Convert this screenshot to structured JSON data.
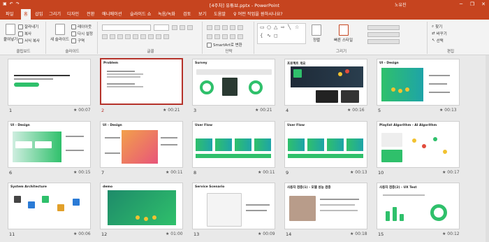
{
  "titlebar": {
    "doc_title": "[4주차] 유튜브.pptx  -  PowerPoint",
    "user": "노유진",
    "minimize": "─",
    "restore": "❐",
    "close": "✕"
  },
  "tabs": [
    {
      "label": "파일"
    },
    {
      "label": "홈"
    },
    {
      "label": "삽입"
    },
    {
      "label": "그리기"
    },
    {
      "label": "디자인"
    },
    {
      "label": "전환"
    },
    {
      "label": "애니메이션"
    },
    {
      "label": "슬라이드 쇼"
    },
    {
      "label": "녹음/녹화"
    },
    {
      "label": "검토"
    },
    {
      "label": "보기"
    },
    {
      "label": "도움말"
    }
  ],
  "search": {
    "label": "어떤 작업을 원하시나요?"
  },
  "ribbon": {
    "clipboard": {
      "paste": "붙여넣기",
      "cut": "잘라내기",
      "copy": "복사",
      "format_painter": "서식 복사",
      "label": "클립보드"
    },
    "slides": {
      "new_slide": "새 슬라이드",
      "layout": "레이아웃",
      "reset": "다시 설정",
      "section": "구역",
      "label": "슬라이드"
    },
    "font": {
      "label": "글꼴"
    },
    "paragraph": {
      "label": "단락",
      "smartart": "SmartArt로 변환"
    },
    "drawing": {
      "label": "그리기",
      "arrange": "정렬",
      "quick_styles": "빠른 스타일"
    },
    "editing": {
      "label": "편집",
      "find": "찾기",
      "replace": "바꾸기",
      "select": "선택"
    }
  },
  "slides": [
    {
      "num": "1",
      "title": "",
      "time": "★ 00:07"
    },
    {
      "num": "2",
      "title": "Problem",
      "time": "★ 00:21"
    },
    {
      "num": "3",
      "title": "Survey",
      "time": "★ 00:21"
    },
    {
      "num": "4",
      "title": "프로젝트 개요",
      "time": "★ 00:16"
    },
    {
      "num": "5",
      "title": "UI - Design",
      "time": "★ 00:13"
    },
    {
      "num": "6",
      "title": "UI - Design",
      "time": "★ 00:15"
    },
    {
      "num": "7",
      "title": "UI - Design",
      "time": "★ 00:11"
    },
    {
      "num": "8",
      "title": "User Flow",
      "time": "★ 00:11"
    },
    {
      "num": "9",
      "title": "User Flow",
      "time": "★ 00:13"
    },
    {
      "num": "10",
      "title": "Playlist Algorithm - AI Algorithm",
      "time": "★ 00:17"
    },
    {
      "num": "11",
      "title": "System Architecture",
      "time": "★ 00:06"
    },
    {
      "num": "12",
      "title": "demo",
      "time": "★ 01:00"
    },
    {
      "num": "13",
      "title": "Service Scenario",
      "time": "★ 00:09"
    },
    {
      "num": "14",
      "title": "사용자 검증(1) - 모델 성능 검증",
      "time": "★ 00:18"
    },
    {
      "num": "15",
      "title": "사용자 검증(2) - UX Test",
      "time": "★ 00:12"
    }
  ]
}
